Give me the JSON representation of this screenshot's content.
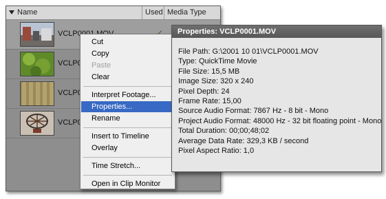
{
  "bin": {
    "columns": {
      "name": "Name",
      "used": "Used",
      "media_type": "Media Type"
    },
    "clips": [
      {
        "name": "VCLP0001.MOV",
        "used": "✓",
        "selected": true
      },
      {
        "name": "VCLP0",
        "used": "",
        "selected": false
      },
      {
        "name": "VCLP0",
        "used": "",
        "selected": false
      },
      {
        "name": "VCLP0",
        "used": "",
        "selected": false
      }
    ]
  },
  "context_menu": {
    "items": [
      {
        "label": "Cut",
        "enabled": true
      },
      {
        "label": "Copy",
        "enabled": true
      },
      {
        "label": "Paste",
        "enabled": false
      },
      {
        "label": "Clear",
        "enabled": true
      },
      {
        "label": "Interpret Footage...",
        "enabled": true
      },
      {
        "label": "Properties...",
        "enabled": true,
        "highlighted": true
      },
      {
        "label": "Rename",
        "enabled": true
      },
      {
        "label": "Insert to Timeline",
        "enabled": true
      },
      {
        "label": "Overlay",
        "enabled": true
      },
      {
        "label": "Time Stretch...",
        "enabled": true
      },
      {
        "label": "Open in Clip Monitor",
        "enabled": true
      }
    ]
  },
  "properties": {
    "title": "Properties: VCLP0001.MOV",
    "lines": [
      "File Path: G:\\2001 10 01\\VCLP0001.MOV",
      "Type: QuickTime Movie",
      "File Size: 15,5 MB",
      "Image Size: 320 x 240",
      "Pixel Depth: 24",
      "Frame Rate: 15,00",
      "Source Audio Format: 7867 Hz - 8 bit - Mono",
      "Project Audio Format: 48000 Hz - 32 bit floating point - Mono",
      "Total Duration: 00;00;48;02",
      "Average Data Rate: 329,3 KB / second",
      "Pixel Aspect Ratio: 1,0"
    ]
  },
  "colors": {
    "menu_highlight": "#3869c4",
    "panel_title": "#5f5f5f",
    "bin_background": "#8e8e8e"
  },
  "icons": {
    "sort": "triangle-down-icon",
    "used_check": "checkmark-icon"
  }
}
